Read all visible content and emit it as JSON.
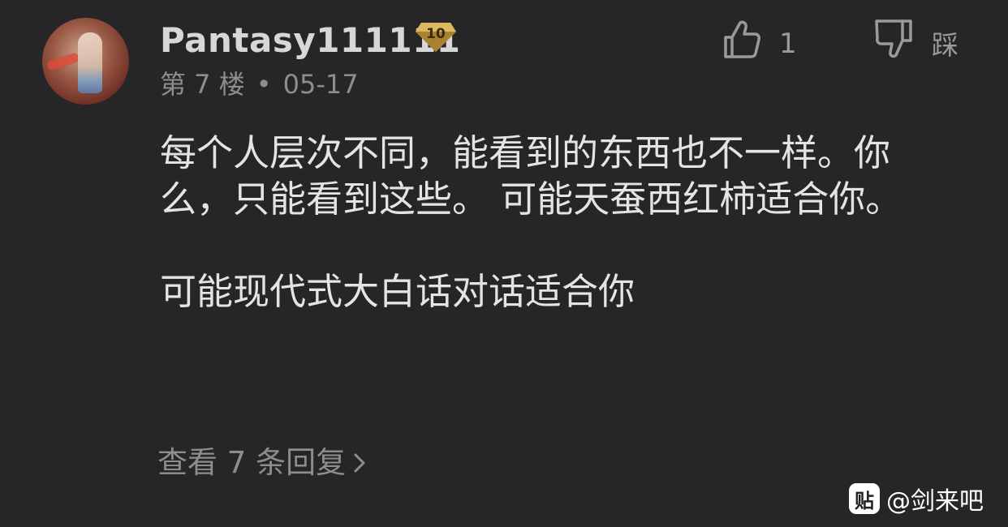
{
  "post": {
    "username": "Pantasy111111",
    "level": "10",
    "floor": "第 7 楼",
    "separator": "•",
    "date": "05-17",
    "like_count": "1",
    "dislike_label": "踩",
    "content": [
      "每个人层次不同，能看到的东西也不一样。你么，只能看到这些。 可能天蚕西红柿适合你。",
      "可能现代式大白话对话适合你"
    ],
    "replies_label": "查看 7 条回复"
  },
  "watermark": {
    "logo": "贴",
    "text": "@剑来吧"
  },
  "colors": {
    "background": "#262628",
    "badge_gold": "#c9a24a",
    "text_primary": "#e4e4e4",
    "text_secondary": "#8d8d8f"
  },
  "icons": {
    "like": "thumbs-up-icon",
    "dislike": "thumbs-down-icon",
    "level": "diamond-badge-icon",
    "replies": "chevron-right-icon"
  }
}
